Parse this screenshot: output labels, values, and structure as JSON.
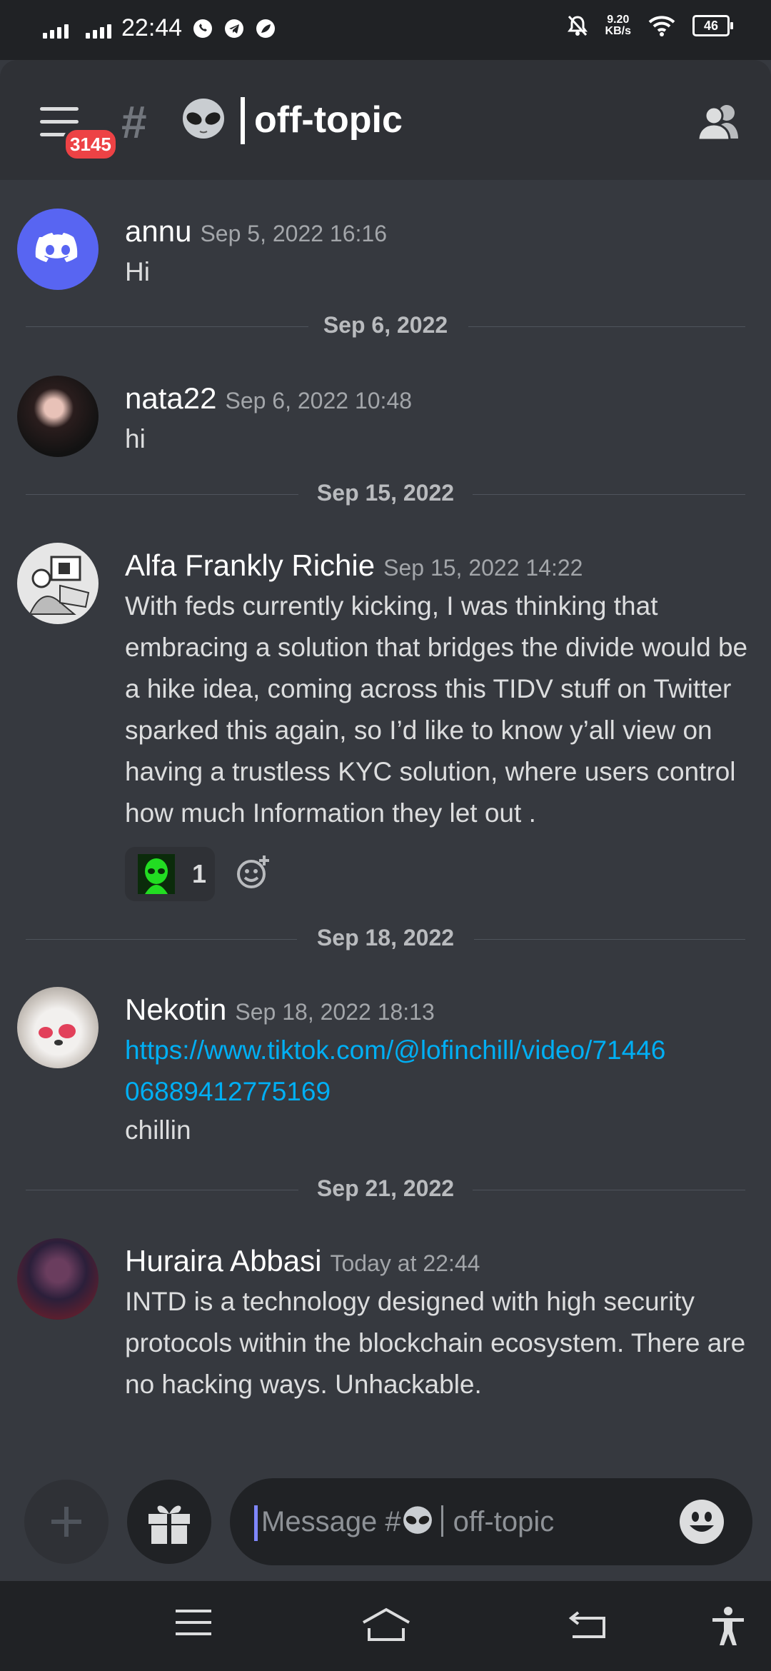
{
  "status_bar": {
    "time": "22:44",
    "net_speed_value": "9.20",
    "net_speed_unit": "KB/s",
    "battery": "46"
  },
  "header": {
    "notification_count": "3145",
    "channel_prefix": "#",
    "channel_name": "off-topic"
  },
  "messages": [
    {
      "author": "annu",
      "timestamp": "Sep 5, 2022 16:16",
      "text": "Hi"
    },
    {
      "author": "nata22",
      "timestamp": "Sep 6, 2022 10:48",
      "text": "hi"
    },
    {
      "author": "Alfa Frankly Richie",
      "timestamp": "Sep 15, 2022 14:22",
      "text": "With feds currently kicking, I was thinking that embracing a solution that bridges the divide would be a hike idea, coming across this TIDV stuff on Twitter sparked this again, so I’d like to know y’all view on having a trustless KYC solution, where users control how much Information they let out .",
      "reaction_count": "1"
    },
    {
      "author": "Nekotin",
      "timestamp": "Sep 18, 2022 18:13",
      "link": "https://www.tiktok.com/@lofinchill/video/7144606889412775169",
      "text": "chillin"
    },
    {
      "author": "Huraira Abbasi",
      "timestamp": "Today at 22:44",
      "text": "INTD is a technology designed with high security protocols within the blockchain ecosystem. There are no hacking ways. Unhackable."
    }
  ],
  "dividers": [
    "Sep 6, 2022",
    "Sep 15, 2022",
    "Sep 18, 2022",
    "Sep 21, 2022"
  ],
  "composer": {
    "placeholder_prefix": "Message #",
    "placeholder_channel": "off-topic"
  },
  "colors": {
    "background": "#36393f",
    "header": "#2f3136",
    "discord_blurple": "#5865f2",
    "link": "#00aff4",
    "badge": "#ed4245"
  }
}
